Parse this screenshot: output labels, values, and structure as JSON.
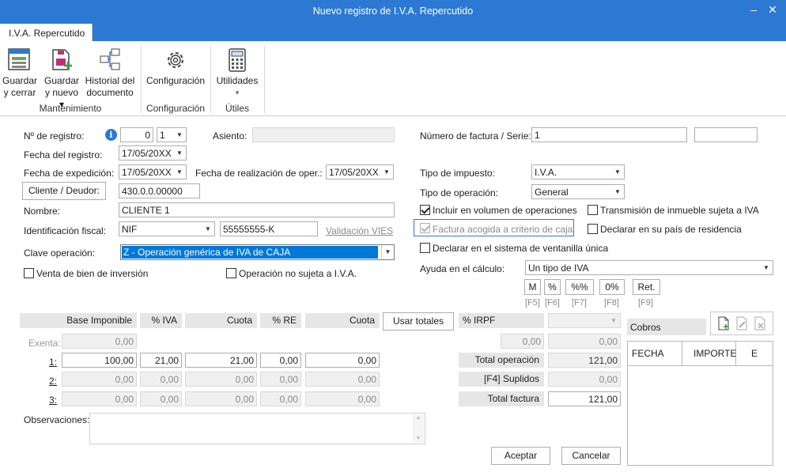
{
  "window": {
    "title": "Nuevo registro de I.V.A. Repercutido",
    "minimize": "–",
    "close": "✕"
  },
  "ribbon": {
    "tab": "I.V.A. Repercutido",
    "buttons": {
      "guardar_cerrar": [
        "Guardar",
        "y cerrar"
      ],
      "guardar_nuevo": [
        "Guardar",
        "y nuevo ▾"
      ],
      "historial": [
        "Historial del",
        "documento"
      ],
      "configuracion": "Configuración",
      "utilidades": "Utilidades",
      "utilidades_arrow": "▾"
    },
    "groups": {
      "mantenimiento": "Mantenimiento",
      "configuracion": "Configuración",
      "utiles": "Útiles"
    }
  },
  "form": {
    "num_registro_label": "Nº de registro:",
    "num_registro_value": "0",
    "num_registro_select": "1",
    "asiento_label": "Asiento:",
    "asiento_value": "",
    "fecha_registro_label": "Fecha del registro:",
    "fecha_registro_value": "17/05/20XX",
    "fecha_expedicion_label": "Fecha de expedición:",
    "fecha_expedicion_value": "17/05/20XX",
    "fecha_realizacion_label": "Fecha de realización de oper.:",
    "fecha_realizacion_value": "17/05/20XX",
    "cliente_button": "Cliente / Deudor:",
    "cliente_value": "430.0.0.00000",
    "nombre_label": "Nombre:",
    "nombre_value": "CLIENTE 1",
    "ident_fiscal_label": "Identificación fiscal:",
    "ident_fiscal_type": "NIF",
    "ident_fiscal_value": "55555555-K",
    "validacion_vies": "Validación VIES",
    "clave_label": "Clave operación:",
    "clave_value": "Z - Operación genérica de IVA de CAJA",
    "venta_bien": "Venta de bien de inversión",
    "operacion_no_sujeta": "Operación no sujeta a I.V.A.",
    "num_factura_label": "Número de factura / Serie:",
    "num_factura_value": "1",
    "serie_value": "",
    "tipo_impuesto_label": "Tipo de impuesto:",
    "tipo_impuesto_value": "I.V.A.",
    "tipo_operacion_label": "Tipo de operación:",
    "tipo_operacion_value": "General",
    "incluir_volumen": "Incluir en volumen de operaciones",
    "transmision_inmueble": "Transmisión de inmueble sujeta a IVA",
    "factura_caja": "Factura acogida a criterio de caja",
    "declarar_pais": "Declarar en su país de residencia",
    "declarar_ventanilla": "Declarar en el sistema de ventanilla única",
    "ayuda_label": "Ayuda en el cálculo:",
    "ayuda_value": "Un tipo de IVA",
    "calc_buttons": [
      {
        "label": "M",
        "key": "[F5]"
      },
      {
        "label": "%",
        "key": "[F6]"
      },
      {
        "label": "%%",
        "key": "[F7]"
      },
      {
        "label": "0%",
        "key": "[F8]"
      },
      {
        "label": "Ret.",
        "key": "[F9]"
      }
    ]
  },
  "grid": {
    "headers": {
      "base": "Base Imponible",
      "iva": "% IVA",
      "cuota": "Cuota",
      "re": "% RE",
      "cuota_re": "Cuota",
      "usar_totales": "Usar totales",
      "irpf": "% IRPF"
    },
    "rows": [
      {
        "label": "Exenta:",
        "base": "0,00",
        "iva": "",
        "cuota": "",
        "re": "",
        "cuota_re": ""
      },
      {
        "label": "1:",
        "base": "100,00",
        "iva": "21,00",
        "cuota": "21,00",
        "re": "0,00",
        "cuota_re": "0,00"
      },
      {
        "label": "2:",
        "base": "0,00",
        "iva": "0,00",
        "cuota": "0,00",
        "re": "0,00",
        "cuota_re": "0,00"
      },
      {
        "label": "3:",
        "base": "0,00",
        "iva": "0,00",
        "cuota": "0,00",
        "re": "0,00",
        "cuota_re": "0,00"
      }
    ],
    "irpf_select": "",
    "irpf_base": "0,00",
    "irpf_cuota": "0,00",
    "total_operacion_label": "Total operación",
    "total_operacion": "121,00",
    "suplidos_label": "[F4] Suplidos",
    "suplidos": "0,00",
    "total_factura_label": "Total factura",
    "total_factura": "121,00"
  },
  "observaciones_label": "Observaciones:",
  "observaciones_value": "",
  "cobros": {
    "title": "Cobros",
    "columns": [
      "FECHA",
      "IMPORTE",
      "E"
    ]
  },
  "footer": {
    "aceptar": "Aceptar",
    "cancelar": "Cancelar"
  },
  "colors": {
    "titlebar": "#2b79d3",
    "selection": "#0078d7",
    "info": "#2b79d3"
  }
}
